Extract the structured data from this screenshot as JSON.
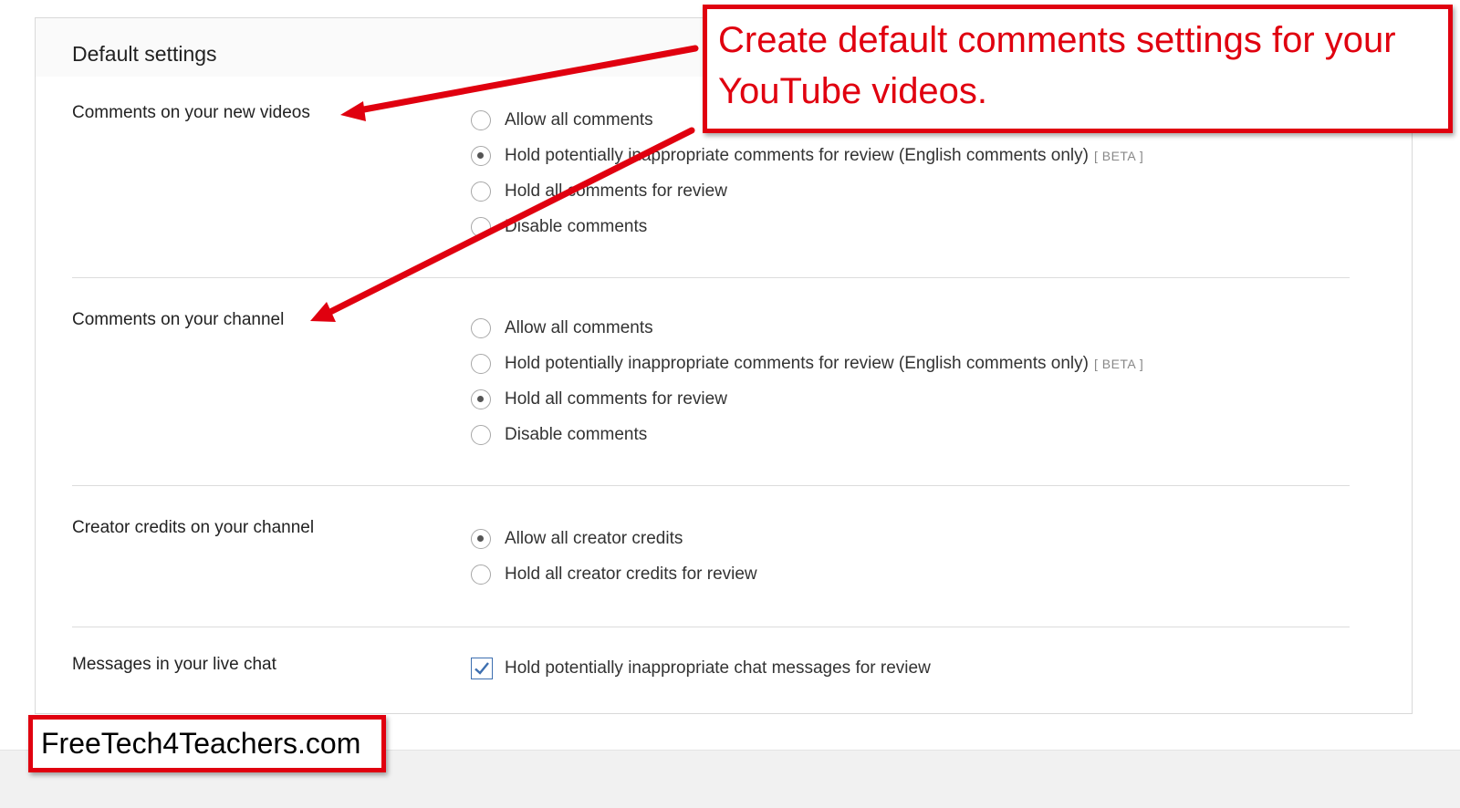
{
  "panel": {
    "title": "Default settings"
  },
  "sections": [
    {
      "label": "Comments on your new videos",
      "options": [
        {
          "label": "Allow all comments",
          "selected": false
        },
        {
          "label": "Hold potentially inappropriate comments for review (English comments only)",
          "badge": "[ BETA ]",
          "selected": true
        },
        {
          "label": "Hold all comments for review",
          "selected": false
        },
        {
          "label": "Disable comments",
          "selected": false
        }
      ]
    },
    {
      "label": "Comments on your channel",
      "options": [
        {
          "label": "Allow all comments",
          "selected": false
        },
        {
          "label": "Hold potentially inappropriate comments for review (English comments only)",
          "badge": "[ BETA ]",
          "selected": false
        },
        {
          "label": "Hold all comments for review",
          "selected": true
        },
        {
          "label": "Disable comments",
          "selected": false
        }
      ]
    },
    {
      "label": "Creator credits on your channel",
      "options": [
        {
          "label": "Allow all creator credits",
          "selected": true
        },
        {
          "label": "Hold all creator credits for review",
          "selected": false
        }
      ]
    },
    {
      "label": "Messages in your live chat",
      "checkbox": {
        "label": "Hold potentially inappropriate chat messages for review",
        "checked": true
      }
    }
  ],
  "annotation": {
    "callout": "Create default comments settings for your YouTube videos.",
    "brand": "FreeTech4Teachers.com",
    "color": "#e0000f"
  }
}
